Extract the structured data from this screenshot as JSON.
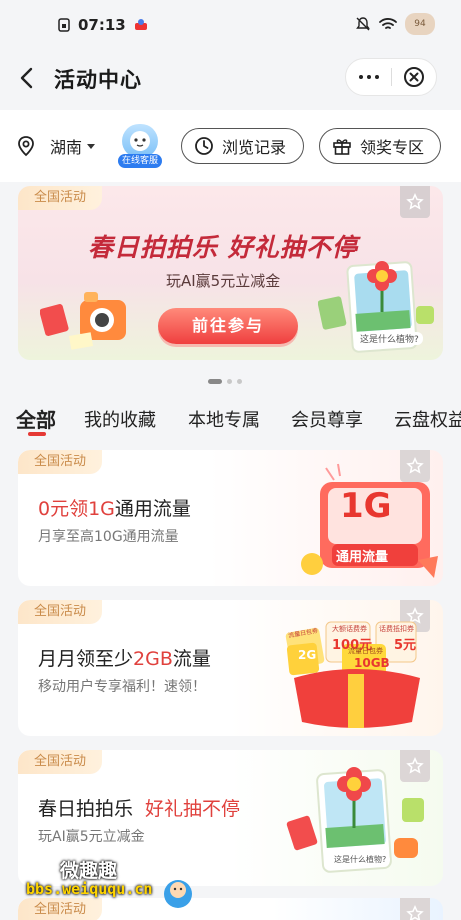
{
  "status_bar": {
    "time": "07:13",
    "battery": "94"
  },
  "header": {
    "title": "活动中心"
  },
  "location": {
    "region": "湖南",
    "service_label": "在线客服",
    "history": "浏览记录",
    "prize_zone": "领奖专区"
  },
  "banner": {
    "tag": "全国活动",
    "title": "春日拍拍乐  好礼抽不停",
    "subtitle": "玩AI赢5元立减金",
    "button": "前往参与",
    "art_caption": "这是什么植物?"
  },
  "tabs": [
    "全部",
    "我的收藏",
    "本地专属",
    "会员尊享",
    "云盘权益"
  ],
  "cards": [
    {
      "tag": "全国活动",
      "title_prefix": "0元领1G",
      "title_suffix": "通用流量",
      "subtitle": "月享至高10G通用流量",
      "art_big": "1G",
      "art_label": "通用流量"
    },
    {
      "tag": "全国活动",
      "title_prefix": "月月领至少",
      "title_highlight": "2GB",
      "title_suffix": "流量",
      "subtitle": "移动用户专享福利！速领！",
      "art_c1_top": "大额话费券",
      "art_c1_big": "100元",
      "art_c2_top": "流量日包券",
      "art_c2_big": "10GB",
      "art_c3_top": "话费抵扣券",
      "art_c3_big": "5元",
      "art_small": "2G",
      "art_c0_top": "流量日包券"
    },
    {
      "tag": "全国活动",
      "title_prefix": "春日拍拍乐",
      "title_highlight": "好礼抽不停",
      "subtitle": "玩AI赢5元立减金",
      "art_caption": "这是什么植物?"
    },
    {
      "tag": "全国活动"
    }
  ],
  "watermark": {
    "cn": "微趣趣",
    "url": "bbs.weiququ.cn"
  },
  "colors": {
    "accent": "#e53935",
    "tag_text": "#c98b4a"
  }
}
